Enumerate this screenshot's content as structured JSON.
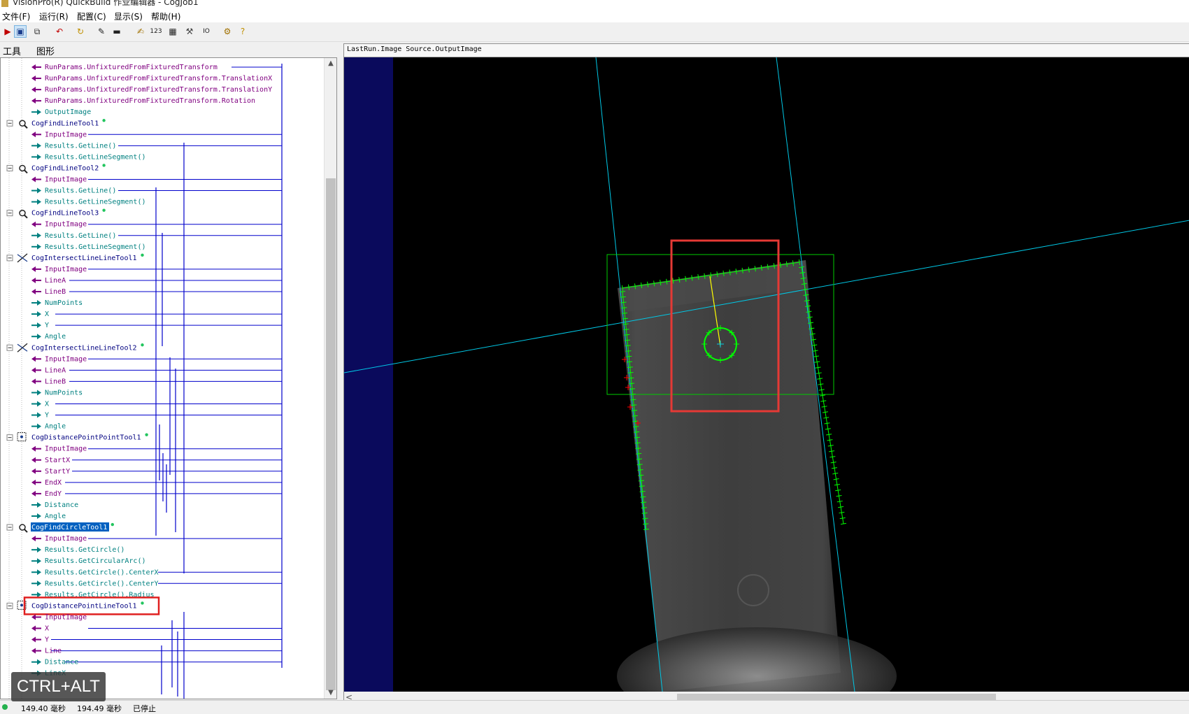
{
  "window": {
    "title": "VisionPro(R) QuickBuild 作业编辑器 - CogJob1"
  },
  "menu": [
    {
      "label": "文件(F)"
    },
    {
      "label": "运行(R)"
    },
    {
      "label": "配置(C)"
    },
    {
      "label": "显示(S)"
    },
    {
      "label": "帮助(H)"
    }
  ],
  "toolbar": {
    "buttons": [
      {
        "icon": "run-once-icon",
        "glyph": "▶",
        "color": "#c00000"
      },
      {
        "icon": "image-view-icon",
        "glyph": "▣",
        "color": "#1a3d8c"
      },
      {
        "icon": "windows-icon",
        "glyph": "⧉",
        "color": "#333333"
      },
      {
        "icon": "reset-icon",
        "glyph": "↶",
        "color": "#c00000"
      },
      {
        "icon": "refresh-icon",
        "glyph": "↻",
        "color": "#c09000"
      },
      {
        "icon": "wand-icon",
        "glyph": "✎",
        "color": "#222222"
      },
      {
        "icon": "record-icon",
        "glyph": "▬",
        "color": "#222222"
      },
      {
        "icon": "notes-icon",
        "glyph": "✍",
        "color": "#a07000"
      },
      {
        "icon": "numeric-display-icon",
        "glyph": "123",
        "color": "#222222"
      },
      {
        "icon": "results-grid-icon",
        "glyph": "▦",
        "color": "#222222"
      },
      {
        "icon": "tools-icon",
        "glyph": "⚒",
        "color": "#444444"
      },
      {
        "icon": "io-icon",
        "glyph": "IO",
        "color": "#222222"
      },
      {
        "icon": "settings-icon",
        "glyph": "⚙",
        "color": "#a07000"
      },
      {
        "icon": "help-icon",
        "glyph": "?",
        "color": "#c09000"
      }
    ]
  },
  "panel_tabs": [
    {
      "label": "工具"
    },
    {
      "label": "图形"
    }
  ],
  "tree": {
    "rows": [
      {
        "kind": "out",
        "text": "RunParams.UnfixturedFromFixturedTransform"
      },
      {
        "kind": "out",
        "text": "RunParams.UnfixturedFromFixturedTransform.TranslationX"
      },
      {
        "kind": "out",
        "text": "RunParams.UnfixturedFromFixturedTransform.TranslationY"
      },
      {
        "kind": "out",
        "text": "RunParams.UnfixturedFromFixturedTransform.Rotation"
      },
      {
        "kind": "in",
        "text": "OutputImage"
      },
      {
        "kind": "tool",
        "text": "CogFindLineTool1",
        "icon": "find-line-tool-icon"
      },
      {
        "kind": "out",
        "text": "InputImage"
      },
      {
        "kind": "in",
        "text": "Results.GetLine()"
      },
      {
        "kind": "in",
        "text": "Results.GetLineSegment()"
      },
      {
        "kind": "tool",
        "text": "CogFindLineTool2",
        "icon": "find-line-tool-icon"
      },
      {
        "kind": "out",
        "text": "InputImage"
      },
      {
        "kind": "in",
        "text": "Results.GetLine()"
      },
      {
        "kind": "in",
        "text": "Results.GetLineSegment()"
      },
      {
        "kind": "tool",
        "text": "CogFindLineTool3",
        "icon": "find-line-tool-icon"
      },
      {
        "kind": "out",
        "text": "InputImage"
      },
      {
        "kind": "in",
        "text": "Results.GetLine()"
      },
      {
        "kind": "in",
        "text": "Results.GetLineSegment()"
      },
      {
        "kind": "tool",
        "text": "CogIntersectLineLineTool1",
        "icon": "intersect-tool-icon"
      },
      {
        "kind": "out",
        "text": "InputImage"
      },
      {
        "kind": "out",
        "text": "LineA"
      },
      {
        "kind": "out",
        "text": "LineB"
      },
      {
        "kind": "in",
        "text": "NumPoints"
      },
      {
        "kind": "in",
        "text": "X"
      },
      {
        "kind": "in",
        "text": "Y"
      },
      {
        "kind": "in",
        "text": "Angle"
      },
      {
        "kind": "tool",
        "text": "CogIntersectLineLineTool2",
        "icon": "intersect-tool-icon"
      },
      {
        "kind": "out",
        "text": "InputImage"
      },
      {
        "kind": "out",
        "text": "LineA"
      },
      {
        "kind": "out",
        "text": "LineB"
      },
      {
        "kind": "in",
        "text": "NumPoints"
      },
      {
        "kind": "in",
        "text": "X"
      },
      {
        "kind": "in",
        "text": "Y"
      },
      {
        "kind": "in",
        "text": "Angle"
      },
      {
        "kind": "tool",
        "text": "CogDistancePointPointTool1",
        "icon": "distance-tool-icon"
      },
      {
        "kind": "out",
        "text": "InputImage"
      },
      {
        "kind": "out",
        "text": "StartX"
      },
      {
        "kind": "out",
        "text": "StartY"
      },
      {
        "kind": "out",
        "text": "EndX"
      },
      {
        "kind": "out",
        "text": "EndY"
      },
      {
        "kind": "in",
        "text": "Distance"
      },
      {
        "kind": "in",
        "text": "Angle"
      },
      {
        "kind": "tool",
        "text": "CogFindCircleTool1",
        "icon": "find-circle-tool-icon",
        "selected": true
      },
      {
        "kind": "out",
        "text": "InputImage"
      },
      {
        "kind": "in",
        "text": "Results.GetCircle()"
      },
      {
        "kind": "in",
        "text": "Results.GetCircularArc()"
      },
      {
        "kind": "in",
        "text": "Results.GetCircle().CenterX"
      },
      {
        "kind": "in",
        "text": "Results.GetCircle().CenterY"
      },
      {
        "kind": "in",
        "text": "Results.GetCircle().Radius"
      },
      {
        "kind": "tool",
        "text": "CogDistancePointLineTool1",
        "icon": "distance-tool-icon",
        "highlighted": true
      },
      {
        "kind": "out",
        "text": "InputImage"
      },
      {
        "kind": "out",
        "text": "X"
      },
      {
        "kind": "out",
        "text": "Y"
      },
      {
        "kind": "out",
        "text": "Line"
      },
      {
        "kind": "in",
        "text": "Distance"
      },
      {
        "kind": "in",
        "text": "LineX"
      }
    ]
  },
  "image_view": {
    "source_label": "LastRun.Image Source.OutputImage"
  },
  "status": {
    "time1": "149.40 毫秒",
    "time2": "194.49 毫秒",
    "state": "已停止"
  },
  "overlay": {
    "text": "CTRL+ALT"
  },
  "colors": {
    "link_in": "#800080",
    "link_out": "#008080",
    "wire": "#0000cc",
    "tool_text": "#000080",
    "highlight": "#e02020",
    "edge_green": "#00ff00",
    "reject_red": "#ff0000",
    "cyan_line": "#00c8e6"
  }
}
